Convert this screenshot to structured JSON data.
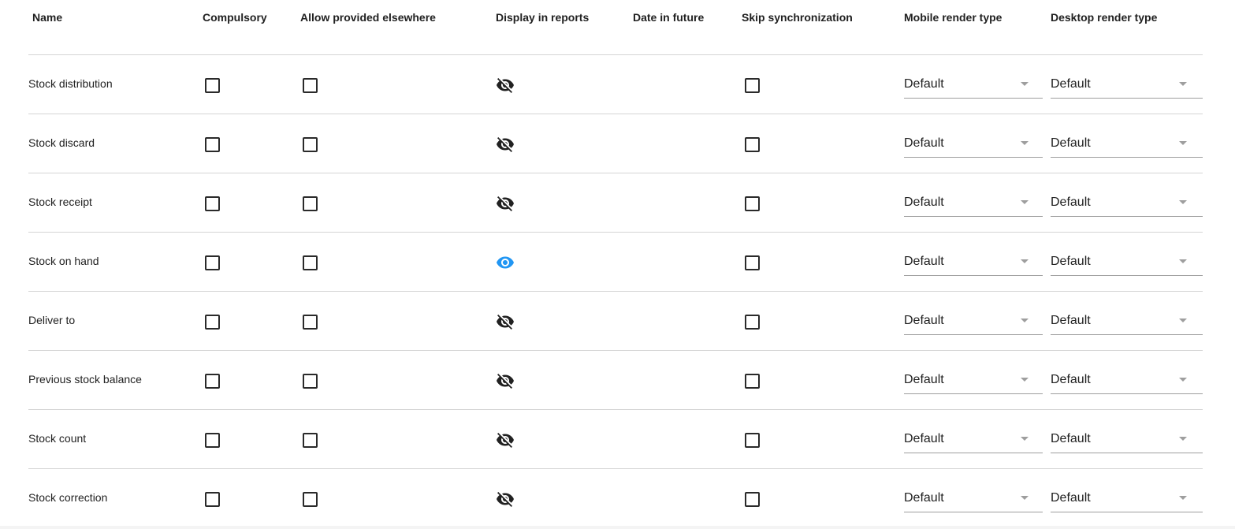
{
  "columns": {
    "name": "Name",
    "compulsory": "Compulsory",
    "allow_provided_elsewhere": "Allow provided elsewhere",
    "display_in_reports": "Display in reports",
    "date_in_future": "Date in future",
    "skip_synchronization": "Skip synchronization",
    "mobile_render_type": "Mobile render type",
    "desktop_render_type": "Desktop render type"
  },
  "rows": [
    {
      "name": "Stock distribution",
      "compulsory": false,
      "allow_provided_elsewhere": false,
      "display_in_reports": false,
      "skip_synchronization": false,
      "mobile_render_type": "Default",
      "desktop_render_type": "Default"
    },
    {
      "name": "Stock discard",
      "compulsory": false,
      "allow_provided_elsewhere": false,
      "display_in_reports": false,
      "skip_synchronization": false,
      "mobile_render_type": "Default",
      "desktop_render_type": "Default"
    },
    {
      "name": "Stock receipt",
      "compulsory": false,
      "allow_provided_elsewhere": false,
      "display_in_reports": false,
      "skip_synchronization": false,
      "mobile_render_type": "Default",
      "desktop_render_type": "Default"
    },
    {
      "name": "Stock on hand",
      "compulsory": false,
      "allow_provided_elsewhere": false,
      "display_in_reports": true,
      "skip_synchronization": false,
      "mobile_render_type": "Default",
      "desktop_render_type": "Default"
    },
    {
      "name": "Deliver to",
      "compulsory": false,
      "allow_provided_elsewhere": false,
      "display_in_reports": false,
      "skip_synchronization": false,
      "mobile_render_type": "Default",
      "desktop_render_type": "Default"
    },
    {
      "name": "Previous stock balance",
      "compulsory": false,
      "allow_provided_elsewhere": false,
      "display_in_reports": false,
      "skip_synchronization": false,
      "mobile_render_type": "Default",
      "desktop_render_type": "Default"
    },
    {
      "name": "Stock count",
      "compulsory": false,
      "allow_provided_elsewhere": false,
      "display_in_reports": false,
      "skip_synchronization": false,
      "mobile_render_type": "Default",
      "desktop_render_type": "Default"
    },
    {
      "name": "Stock correction",
      "compulsory": false,
      "allow_provided_elsewhere": false,
      "display_in_reports": false,
      "skip_synchronization": false,
      "mobile_render_type": "Default",
      "desktop_render_type": "Default"
    }
  ],
  "icons": {
    "display_on": "eye-icon",
    "display_off": "eye-off-icon"
  },
  "colors": {
    "eye_on": "#2196f3",
    "eye_off": "#212121"
  }
}
